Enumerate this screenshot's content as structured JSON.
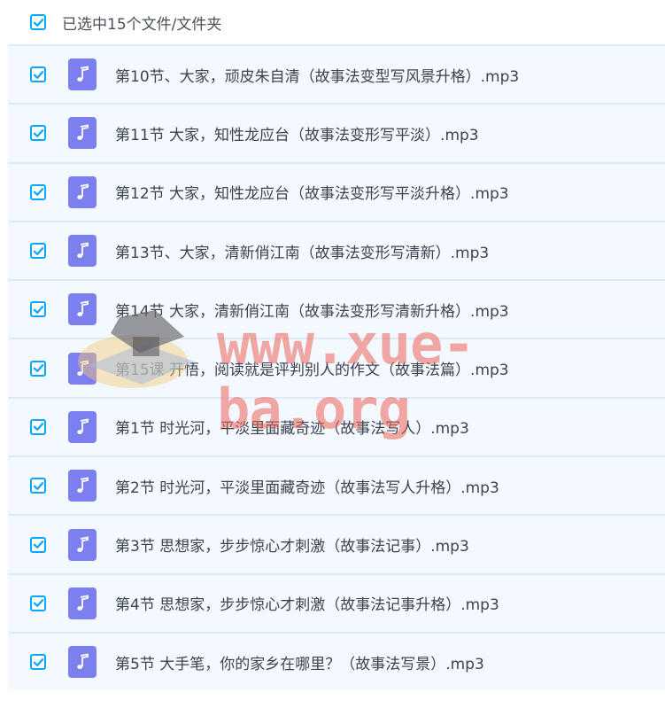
{
  "header": {
    "label": "已选中15个文件/文件夹",
    "checked": true
  },
  "files": [
    {
      "name": "第10节、大家，顽皮朱自清（故事法变型写风景升格）.mp3",
      "checked": true
    },
    {
      "name": "第11节 大家，知性龙应台（故事法变形写平淡）.mp3",
      "checked": true
    },
    {
      "name": "第12节 大家，知性龙应台（故事法变形写平淡升格）.mp3",
      "checked": true
    },
    {
      "name": "第13节、大家，清新俏江南（故事法变形写清新）.mp3",
      "checked": true
    },
    {
      "name": "第14节 大家，清新俏江南（故事法变形写清新升格）.mp3",
      "checked": true
    },
    {
      "name": "第15课 开悟，阅读就是评判别人的作文（故事法篇）.mp3",
      "checked": true
    },
    {
      "name": "第1节 时光河，平淡里面藏奇迹（故事法写人）.mp3",
      "checked": true
    },
    {
      "name": "第2节 时光河，平淡里面藏奇迹（故事法写人升格）.mp3",
      "checked": true
    },
    {
      "name": "第3节 思想家，步步惊心才刺激（故事法记事）.mp3",
      "checked": true
    },
    {
      "name": "第4节 思想家，步步惊心才刺激（故事法记事升格）.mp3",
      "checked": true
    },
    {
      "name": "第5节 大手笔，你的家乡在哪里？（故事法写景）.mp3",
      "checked": true
    }
  ],
  "watermark": "www.xue-ba.org",
  "icons": {
    "checkbox": "checkbox-checked-icon",
    "file": "music-file-icon"
  },
  "colors": {
    "accent": "#06a7ff",
    "file_icon": "#7c7ff0",
    "row_bg": "#f3f9fe",
    "row_border": "#dcebf7"
  }
}
